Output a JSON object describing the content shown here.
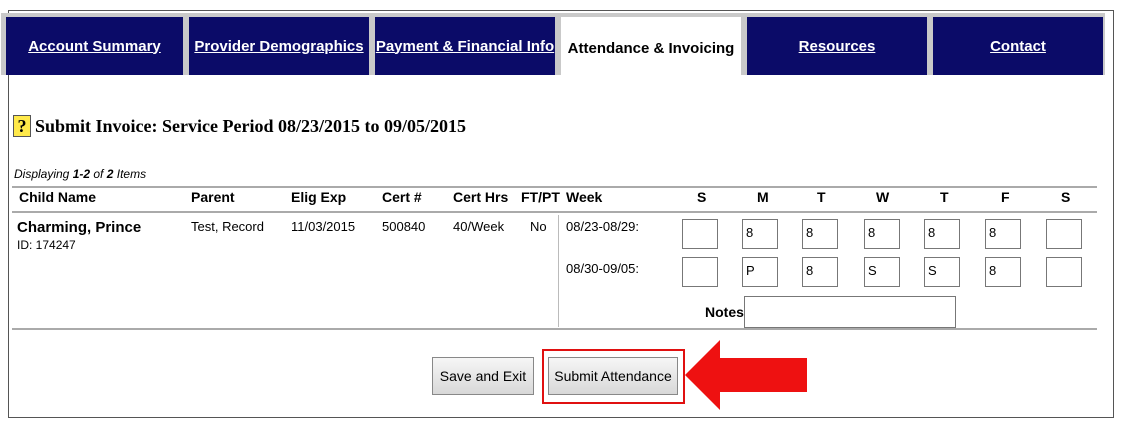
{
  "tabs": [
    {
      "label": "Account Summary"
    },
    {
      "label": "Provider Demographics"
    },
    {
      "label": "Payment & Financial Info"
    },
    {
      "label": "Attendance & Invoicing"
    },
    {
      "label": "Resources"
    },
    {
      "label": "Contact"
    }
  ],
  "active_tab": "Attendance & Invoicing",
  "help_icon_glyph": "?",
  "page_title": "Submit Invoice: Service Period 08/23/2015 to 09/05/2015",
  "paging": {
    "prefix": "Displaying ",
    "range": "1-2",
    "mid": " of ",
    "total": "2",
    "suffix": " Items"
  },
  "columns": [
    "Child Name",
    "Parent",
    "Elig Exp",
    "Cert #",
    "Cert Hrs",
    "FT/PT",
    "Week",
    "S",
    "M",
    "T",
    "W",
    "T",
    "F",
    "S"
  ],
  "row": {
    "child_name": "Charming, Prince",
    "child_id": "ID: 174247",
    "parent": "Test, Record",
    "elig_exp": "11/03/2015",
    "cert_num": "500840",
    "cert_hrs": "40/Week",
    "ftpt": "No",
    "weeks": [
      {
        "label": "08/23-08/29:",
        "days": [
          "",
          "8",
          "8",
          "8",
          "8",
          "8",
          ""
        ]
      },
      {
        "label": "08/30-09/05:",
        "days": [
          "",
          "P",
          "8",
          "S",
          "S",
          "8",
          ""
        ]
      }
    ]
  },
  "notes_label": "Notes:",
  "notes_value": "",
  "buttons": {
    "save_exit": "Save and Exit",
    "submit": "Submit Attendance"
  },
  "colors": {
    "tab_bg": "#0b0b68",
    "highlight": "#e01010",
    "help_bg": "#ffe94a"
  }
}
